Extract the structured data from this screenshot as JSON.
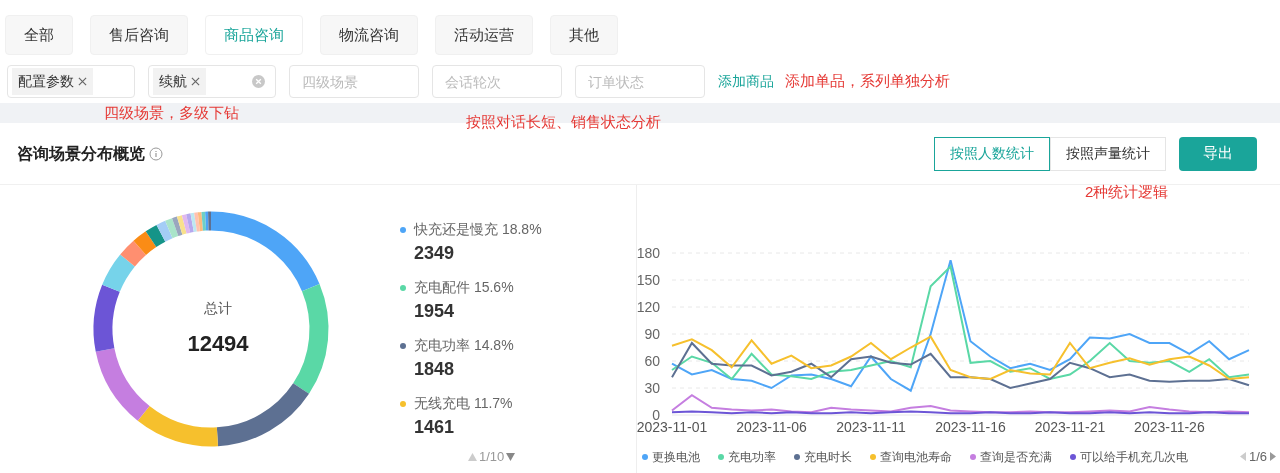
{
  "tabs": [
    {
      "label": "全部",
      "selected": false
    },
    {
      "label": "售后咨询",
      "selected": false
    },
    {
      "label": "商品咨询",
      "selected": true
    },
    {
      "label": "物流咨询",
      "selected": false
    },
    {
      "label": "活动运营",
      "selected": false
    },
    {
      "label": "其他",
      "selected": false
    }
  ],
  "filters": [
    {
      "kind": "tags",
      "tags": [
        "配置参数"
      ],
      "clearable": false
    },
    {
      "kind": "tags",
      "tags": [
        "续航"
      ],
      "clearable": true
    },
    {
      "kind": "select",
      "placeholder": "四级场景"
    },
    {
      "kind": "select",
      "placeholder": "会话轮次"
    },
    {
      "kind": "select",
      "placeholder": "订单状态"
    }
  ],
  "add_link": "添加商品",
  "annotations": {
    "add": "添加单品，系列单独分析",
    "level": "四级场景，多级下钻",
    "dialog": "按照对话长短、销售状态分析",
    "stats": "2种统计逻辑"
  },
  "card": {
    "title": "咨询场景分布概览",
    "toggles": [
      {
        "label": "按照人数统计",
        "selected": true
      },
      {
        "label": "按照声量统计",
        "selected": false
      }
    ],
    "export": "导出"
  },
  "donut": {
    "center_label": "总计",
    "total": "12494",
    "pager": "1/10",
    "items": [
      {
        "name": "快充还是慢充",
        "percent": "18.8%",
        "count": "2349",
        "color": "#4ea5f7"
      },
      {
        "name": "充电配件",
        "percent": "15.6%",
        "count": "1954",
        "color": "#5ad8a6"
      },
      {
        "name": "充电功率",
        "percent": "14.8%",
        "count": "1848",
        "color": "#5d7092"
      },
      {
        "name": "无线充电",
        "percent": "11.7%",
        "count": "1461",
        "color": "#f6c02d"
      }
    ]
  },
  "line": {
    "pager": "1/6",
    "chart_data": {
      "type": "line",
      "x": [
        "2023-11-01",
        "2023-11-02",
        "2023-11-03",
        "2023-11-04",
        "2023-11-05",
        "2023-11-06",
        "2023-11-07",
        "2023-11-08",
        "2023-11-09",
        "2023-11-10",
        "2023-11-11",
        "2023-11-12",
        "2023-11-13",
        "2023-11-14",
        "2023-11-15",
        "2023-11-16",
        "2023-11-17",
        "2023-11-18",
        "2023-11-19",
        "2023-11-20",
        "2023-11-21",
        "2023-11-22",
        "2023-11-23",
        "2023-11-24",
        "2023-11-25",
        "2023-11-26",
        "2023-11-27",
        "2023-11-28",
        "2023-11-29",
        "2023-11-30"
      ],
      "xticks": [
        "2023-11-01",
        "2023-11-06",
        "2023-11-11",
        "2023-11-16",
        "2023-11-21",
        "2023-11-26"
      ],
      "yticks": [
        0,
        30,
        60,
        90,
        120,
        150,
        180
      ],
      "ylim": [
        0,
        180
      ],
      "xlim": [
        "2023-11-01",
        "2023-11-30"
      ],
      "grid": true,
      "series": [
        {
          "name": "更换电池",
          "color": "#4ea5f7",
          "values": [
            57,
            45,
            50,
            40,
            38,
            30,
            44,
            45,
            40,
            32,
            65,
            40,
            27,
            90,
            172,
            82,
            65,
            52,
            57,
            50,
            62,
            86,
            85,
            90,
            80,
            80,
            68,
            82,
            62,
            72
          ]
        },
        {
          "name": "充电功率",
          "color": "#5ad8a6",
          "values": [
            50,
            65,
            58,
            40,
            68,
            45,
            43,
            40,
            48,
            50,
            55,
            60,
            53,
            143,
            165,
            58,
            60,
            48,
            52,
            40,
            45,
            60,
            80,
            60,
            58,
            60,
            48,
            62,
            42,
            45
          ]
        },
        {
          "name": "充电时长",
          "color": "#5d7092",
          "values": [
            42,
            80,
            57,
            55,
            55,
            44,
            48,
            57,
            42,
            62,
            65,
            58,
            56,
            68,
            42,
            42,
            40,
            30,
            35,
            40,
            58,
            52,
            42,
            45,
            38,
            37,
            38,
            38,
            40,
            33
          ]
        },
        {
          "name": "查询电池寿命",
          "color": "#f6c02d",
          "values": [
            77,
            84,
            72,
            53,
            83,
            57,
            66,
            52,
            55,
            65,
            80,
            62,
            75,
            87,
            50,
            42,
            40,
            50,
            46,
            45,
            80,
            52,
            58,
            63,
            56,
            62,
            65,
            55,
            40,
            42
          ]
        },
        {
          "name": "查询是否充满",
          "color": "#c57ee0",
          "values": [
            5,
            22,
            8,
            6,
            5,
            6,
            4,
            3,
            8,
            6,
            5,
            4,
            8,
            10,
            5,
            4,
            3,
            3,
            4,
            3,
            3,
            4,
            5,
            4,
            9,
            6,
            4,
            3,
            4,
            3
          ]
        },
        {
          "name": "可以给手机充几次电",
          "color": "#6c55d6",
          "values": [
            3,
            4,
            3,
            2,
            3,
            2,
            3,
            2,
            2,
            3,
            2,
            3,
            4,
            3,
            2,
            2,
            3,
            2,
            2,
            3,
            2,
            2,
            3,
            2,
            3,
            2,
            2,
            3,
            2,
            2
          ]
        }
      ]
    }
  }
}
